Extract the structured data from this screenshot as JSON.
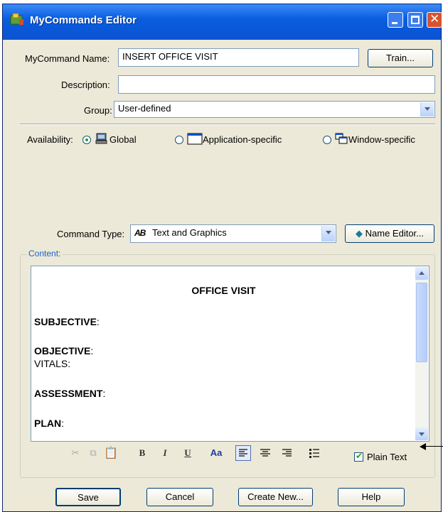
{
  "window": {
    "title": "MyCommands Editor"
  },
  "form": {
    "name_label": "MyCommand Name:",
    "name_value": "INSERT OFFICE VISIT",
    "train_label": "Train...",
    "description_label": "Description:",
    "description_value": "",
    "group_label": "Group:",
    "group_value": "User-defined"
  },
  "availability": {
    "label": "Availability:",
    "options": [
      {
        "label": "Global",
        "selected": true
      },
      {
        "label": "Application-specific",
        "selected": false
      },
      {
        "label": "Window-specific",
        "selected": false
      }
    ]
  },
  "command_type": {
    "label": "Command Type:",
    "icon_text": "AB",
    "value": "Text and Graphics",
    "name_editor_label": "Name Editor..."
  },
  "content": {
    "group_label": "Content:",
    "heading": "OFFICE VISIT",
    "sections": [
      {
        "title": "SUBJECTIVE",
        "suffix": ":"
      },
      {
        "title": "OBJECTIVE",
        "suffix": ":",
        "sub": "VITALS:"
      },
      {
        "title": "ASSESSMENT",
        "suffix": ":"
      },
      {
        "title": "PLAN",
        "suffix": ":"
      }
    ]
  },
  "toolbar": {
    "bold": "B",
    "italic": "I",
    "underline": "U",
    "font": "Aa",
    "plain_text_label": "Plain Text",
    "plain_text_checked": true
  },
  "buttons": {
    "save": "Save",
    "cancel": "Cancel",
    "create_new": "Create New...",
    "help": "Help"
  }
}
